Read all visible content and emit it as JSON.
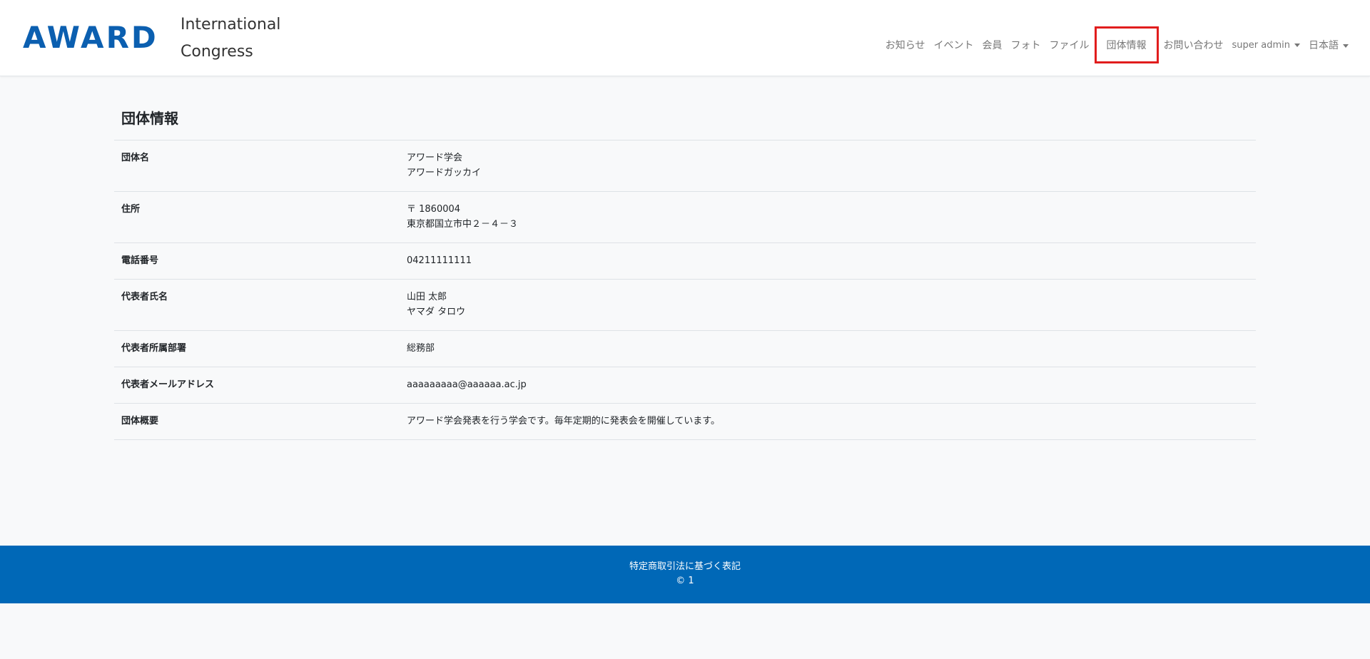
{
  "header": {
    "logo_text": "AWARD",
    "site_name": "International Congress",
    "nav": [
      {
        "label": "お知らせ",
        "active": false
      },
      {
        "label": "イベント",
        "active": false
      },
      {
        "label": "会員",
        "active": false
      },
      {
        "label": "フォト",
        "active": false
      },
      {
        "label": "ファイル",
        "active": false
      },
      {
        "label": "団体情報",
        "active": true
      },
      {
        "label": "お問い合わせ",
        "active": false
      }
    ],
    "user_menu": "super admin",
    "language_menu": "日本語"
  },
  "main": {
    "title": "団体情報",
    "rows": [
      {
        "label": "団体名",
        "values": [
          "アワード学会",
          "アワードガッカイ"
        ]
      },
      {
        "label": "住所",
        "values": [
          "〒 1860004",
          "東京都国立市中２－４－３"
        ]
      },
      {
        "label": "電話番号",
        "values": [
          "04211111111"
        ]
      },
      {
        "label": "代表者氏名",
        "values": [
          "山田 太郎",
          "ヤマダ タロウ"
        ]
      },
      {
        "label": "代表者所属部署",
        "values": [
          "総務部"
        ]
      },
      {
        "label": "代表者メールアドレス",
        "values": [
          "aaaaaaaaa@aaaaaa.ac.jp"
        ]
      },
      {
        "label": "団体概要",
        "values": [
          "アワード学会発表を行う学会です。毎年定期的に発表会を開催しています。"
        ]
      }
    ]
  },
  "footer": {
    "legal_link": "特定商取引法に基づく表記",
    "copyright": "© 1"
  },
  "colors": {
    "brand": "#0b5fb0",
    "footer_bg": "#0068b7",
    "highlight": "#e11d1d"
  }
}
